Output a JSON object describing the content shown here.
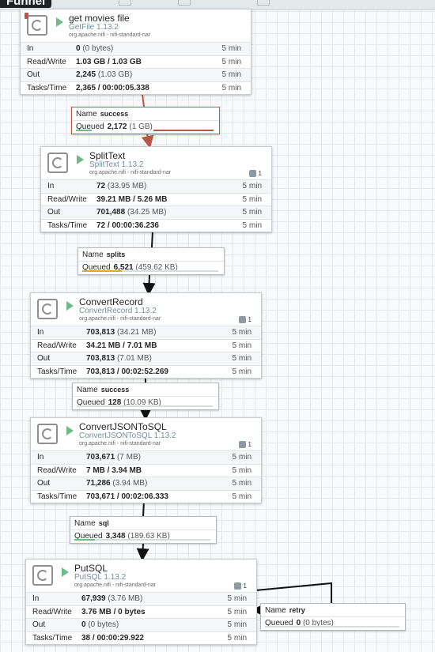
{
  "toolbar": {
    "tooltip": "Funnel"
  },
  "colors": {
    "running": "#6fbb86",
    "selected": "#ba554a",
    "bundle": "#728e9b"
  },
  "processors": [
    {
      "name": "get movies file",
      "type": "GetFile 1.13.2",
      "bundle": "org.apache.nifi - nifi-standard-nar",
      "tasks": "",
      "in": "0",
      "in_sub": "(0 bytes)",
      "rw": "1.03 GB / 1.03 GB",
      "out": "2,245",
      "out_sub": "(1.03 GB)",
      "time": "2,365 / 00:00:05.338",
      "window": "5 min"
    },
    {
      "name": "SplitText",
      "type": "SplitText 1.13.2",
      "bundle": "org.apache.nifi - nifi-standard-nar",
      "tasks": "1",
      "in": "72",
      "in_sub": "(33.95 MB)",
      "rw": "39.21 MB / 5.26 MB",
      "out": "701,488",
      "out_sub": "(34.25 MB)",
      "time": "72 / 00:00:36.236",
      "window": "5 min"
    },
    {
      "name": "ConvertRecord",
      "type": "ConvertRecord 1.13.2",
      "bundle": "org.apache.nifi - nifi-standard-nar",
      "tasks": "1",
      "in": "703,813",
      "in_sub": "(34.21 MB)",
      "rw": "34.21 MB / 7.01 MB",
      "out": "703,813",
      "out_sub": "(7.01 MB)",
      "time": "703,813 / 00:02:52.269",
      "window": "5 min"
    },
    {
      "name": "ConvertJSONToSQL",
      "type": "ConvertJSONToSQL 1.13.2",
      "bundle": "org.apache.nifi - nifi-standard-nar",
      "tasks": "1",
      "in": "703,671",
      "in_sub": "(7 MB)",
      "rw": "7 MB / 3.94 MB",
      "out": "71,286",
      "out_sub": "(3.94 MB)",
      "time": "703,671 / 00:02:06.333",
      "window": "5 min"
    },
    {
      "name": "PutSQL",
      "type": "PutSQL 1.13.2",
      "bundle": "org.apache.nifi - nifi-standard-nar",
      "tasks": "1",
      "in": "67,939",
      "in_sub": "(3.76 MB)",
      "rw": "3.76 MB / 0 bytes",
      "out": "0",
      "out_sub": "(0 bytes)",
      "time": "38 / 00:00:29.922",
      "window": "5 min"
    }
  ],
  "stat_labels": {
    "in": "In",
    "rw": "Read/Write",
    "out": "Out",
    "time": "Tasks/Time"
  },
  "conn_labels": {
    "name": "Name",
    "queued": "Queued"
  },
  "connections": [
    {
      "name": "success",
      "count": "2,172",
      "size": "(1 GB)",
      "fill": 0.1
    },
    {
      "name": "splits",
      "count": "6,521",
      "size": "(459.62 KB)",
      "fill": 0.3
    },
    {
      "name": "success",
      "count": "128",
      "size": "(10.09 KB)",
      "fill": 0.0
    },
    {
      "name": "sql",
      "count": "3,348",
      "size": "(189.63 KB)",
      "fill": 0.15
    },
    {
      "name": "retry",
      "count": "0",
      "size": "(0 bytes)",
      "fill": 0.0
    }
  ]
}
